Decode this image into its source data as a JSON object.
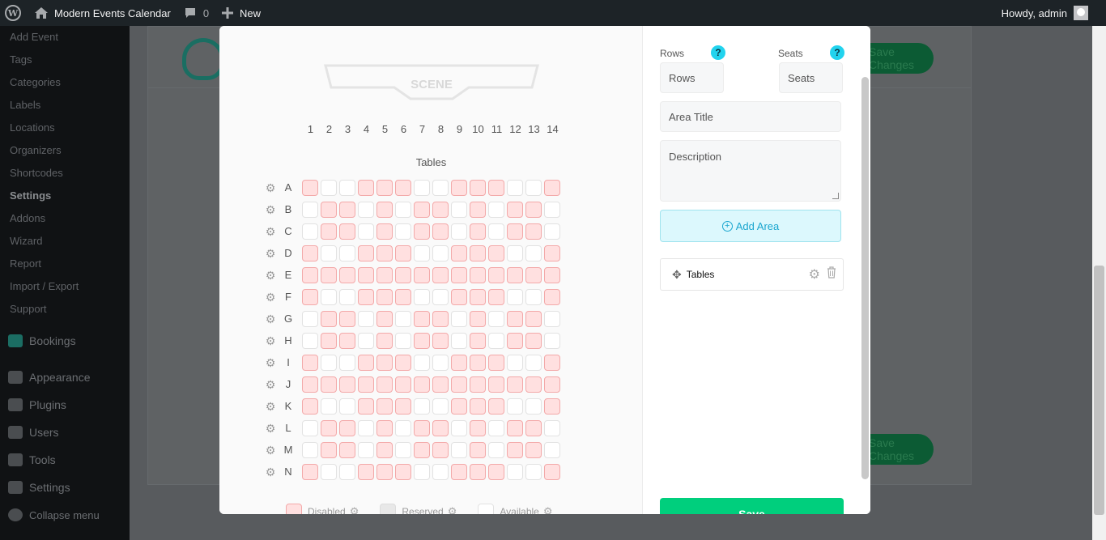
{
  "adminbar": {
    "site_name": "Modern Events Calendar",
    "comments_count": "0",
    "new_label": "New",
    "greeting": "Howdy, admin",
    "icons": [
      "wordpress-icon",
      "home-icon",
      "comment-icon",
      "plus-icon",
      "avatar"
    ]
  },
  "sidebar": {
    "submenu": [
      "Add Event",
      "Tags",
      "Categories",
      "Labels",
      "Locations",
      "Organizers",
      "Shortcodes",
      "Settings",
      "Addons",
      "Wizard",
      "Report",
      "Import / Export",
      "Support"
    ],
    "current": "Settings",
    "main": [
      "Bookings",
      "Appearance",
      "Plugins",
      "Users",
      "Tools",
      "Settings",
      "Collapse menu"
    ]
  },
  "background": {
    "save_changes": "Save Changes"
  },
  "modal": {
    "scene_label": "SCENE",
    "area_title": "Tables",
    "seat_numbers": [
      "1",
      "2",
      "3",
      "4",
      "5",
      "6",
      "7",
      "8",
      "9",
      "10",
      "11",
      "12",
      "13",
      "14"
    ],
    "rows": [
      "A",
      "B",
      "C",
      "D",
      "E",
      "F",
      "G",
      "H",
      "I",
      "J",
      "K",
      "L",
      "M",
      "N"
    ],
    "row_patterns": [
      "10011100111001",
      "01101011010110",
      "01101011010110",
      "10011100111001",
      "11111111111111",
      "10011100111001",
      "01101011010110",
      "01101011010110",
      "10011100111001",
      "11111111111111",
      "10011100111001",
      "01101011010110",
      "01101011010110",
      "10011100111001"
    ],
    "legend": {
      "disabled": "Disabled",
      "reserved": "Reserved",
      "available": "Available"
    },
    "form": {
      "rows_label": "Rows",
      "seats_label": "Seats",
      "rows_placeholder": "Rows",
      "seats_placeholder": "Seats",
      "area_title_placeholder": "Area Title",
      "description_placeholder": "Description",
      "help_symbol": "?",
      "add_area": "Add Area",
      "area_item": "Tables",
      "save": "Save"
    },
    "colors": {
      "disabled_fill": "#ffe0e0",
      "disabled_border": "#f3a9a9",
      "save_button": "#00cf7d",
      "add_area_bg": "#dcf8fd",
      "help_icon": "#22d3ee"
    }
  }
}
